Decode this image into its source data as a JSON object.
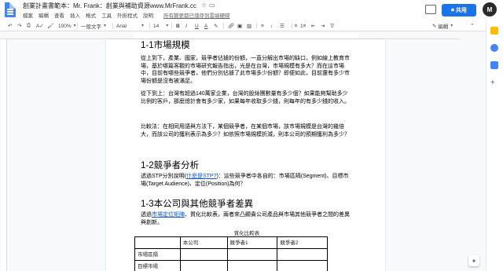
{
  "header": {
    "doc_title": "創業計畫書範本：Mr. Frank：創業與補助資源www.MrFrank.cc",
    "menu": [
      "檔案",
      "編輯",
      "查看",
      "插入",
      "格式",
      "工具",
      "外掛程式",
      "說明"
    ],
    "last_edit": "所有變更都已儲存到雲端硬碟",
    "share_label": "共用",
    "avatar_letter": "M"
  },
  "toolbar": {
    "zoom": "100%",
    "style": "一般文字",
    "font": "Arial",
    "size": "14",
    "bold": "B",
    "italic": "I",
    "underline": "U",
    "text_color": "A",
    "mode": "編輯"
  },
  "sections": [
    {
      "heading": "1-1市場規模",
      "paragraphs": [
        "從上到下，產業、國家，競爭者佔據的份額，一直分解出市場的缺口，例如線上教育市場，基於哪篇客觀的市場研究報告指出，光是在台灣，市場規模有多大？而在這市場中，目前有哪些競爭者，他們分別佔據了此市場多少份額？即便如此，目前還有多少市場份額是沒有被滿足。",
        "從下到上：台灣有超過140萬家企業，台灣的股絲團數量有多少個？如果能夠幫助多少比例的客戶，那麼總計會有多少家，如果每年收取多少錢，則每年的有多少錢的收入。",
        "比較法：在相同用語與方法下，某個競爭者，在某個市場，該市場規模是台灣的幾倍大，而該公司的獲利表示為多少？如依照市場規模折減，則本公司的預期獲利為多少？"
      ]
    },
    {
      "heading": "1-2競爭者分析",
      "p_before": "透過STP分別說明(",
      "p_link": "什麼是STP?",
      "p_after": ")：這些競爭者中各自的：市場區隔(Segment)、目標市場(Target Audience)、定位(Position)為何？"
    },
    {
      "heading": "1-3本公司與其他競爭者差異",
      "p_before": "透過",
      "p_link": "市場定位矩陣",
      "p_after": "、質化比較表，兩者來凸顯貴公司產品與市場其他競爭者之間的差異與創新。"
    }
  ],
  "table": {
    "caption": "質化比較表",
    "header": [
      "",
      "本公司",
      "競爭者1",
      "競爭者2"
    ],
    "rows": [
      [
        "市場區隔",
        "",
        "",
        ""
      ],
      [
        "目標市場",
        "",
        "",
        ""
      ]
    ]
  }
}
